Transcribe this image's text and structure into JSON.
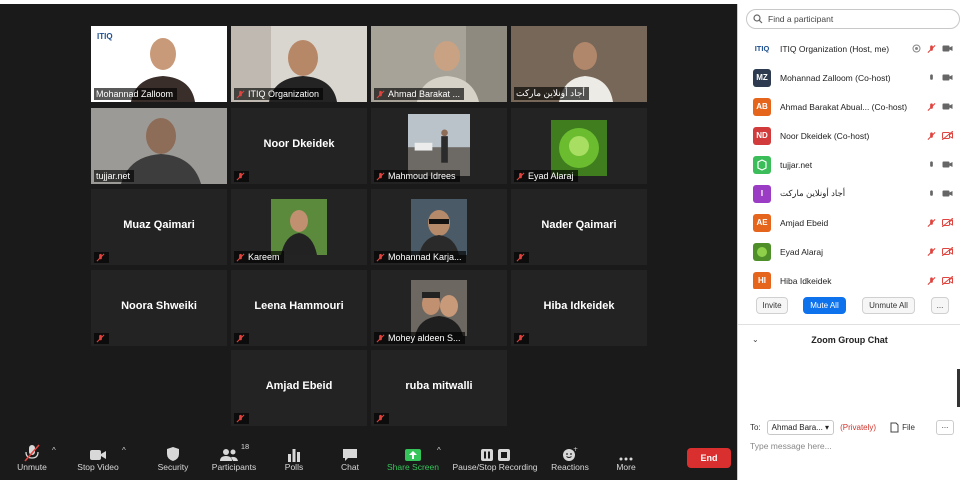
{
  "tiles": [
    {
      "name": "Mohannad Zalloom",
      "logo": "ITIQ",
      "muted": false,
      "active": true
    },
    {
      "name": "ITIQ Organization",
      "muted": true
    },
    {
      "name": "Ahmad Barakat ...",
      "muted": true
    },
    {
      "name": "أجاد أونلاين ماركت",
      "muted": false
    },
    {
      "name": "tujjar.net",
      "muted": false
    },
    {
      "name": "Noor Dkeidek",
      "center": "Noor Dkeidek",
      "muted": true
    },
    {
      "name": "Mahmoud Idrees",
      "muted": true
    },
    {
      "name": "Eyad Alaraj",
      "muted": true
    },
    {
      "center": "Muaz Qaimari",
      "muted": true
    },
    {
      "name": "Kareem",
      "muted": true
    },
    {
      "name": "Mohannad Karja...",
      "muted": true
    },
    {
      "center": "Nader Qaimari",
      "muted": true
    },
    {
      "center": "Noora Shweiki",
      "muted": true
    },
    {
      "center": "Leena Hammouri",
      "muted": true
    },
    {
      "name": "Mohey aldeen S...",
      "muted": true
    },
    {
      "center": "Hiba Idkeidek",
      "muted": true
    },
    {
      "center": "Amjad Ebeid",
      "muted": true
    },
    {
      "center": "ruba mitwalli",
      "muted": true
    }
  ],
  "toolbar": {
    "unmute": "Unmute",
    "stop_video": "Stop Video",
    "security": "Security",
    "participants": "Participants",
    "participants_count": "18",
    "polls": "Polls",
    "chat": "Chat",
    "share_screen": "Share Screen",
    "recording": "Pause/Stop Recording",
    "reactions": "Reactions",
    "more": "More",
    "end": "End"
  },
  "panel": {
    "search_placeholder": "Find a participant",
    "participants": [
      {
        "initials": "ITIQ",
        "name": "ITIQ Organization (Host, me)",
        "color": "#ffffff"
      },
      {
        "initials": "MZ",
        "name": "Mohannad Zalloom (Co-host)",
        "color": "#2d3a4f"
      },
      {
        "initials": "AB",
        "name": "Ahmad Barakat Abual... (Co-host)",
        "color": "#e5651d"
      },
      {
        "initials": "ND",
        "name": "Noor Dkeidek (Co-host)",
        "color": "#d23b3b"
      },
      {
        "initials": "",
        "name": "tujjar.net",
        "color": "#3bbd59"
      },
      {
        "initials": "I",
        "name": "أجاد أونلاين ماركت",
        "color": "#9b3cc4"
      },
      {
        "initials": "AE",
        "name": "Amjad Ebeid",
        "color": "#e5651d"
      },
      {
        "initials": "",
        "name": "Eyad Alaraj",
        "color": "#4f8f2a"
      },
      {
        "initials": "HI",
        "name": "Hiba Idkeidek",
        "color": "#e5651d"
      }
    ],
    "invite": "Invite",
    "mute_all": "Mute All",
    "unmute_all": "Unmute All",
    "more": "...",
    "chat_title": "Zoom Group Chat",
    "to_label": "To:",
    "to_value": "Ahmad Bara...",
    "privately": "(Privately)",
    "file": "File",
    "message_placeholder": "Type message here..."
  },
  "colors": {
    "active_border": "#b4e23a",
    "share_green": "#35c45a",
    "end_red": "#d9302f",
    "mute_all_blue": "#0e72ed",
    "muted_red": "#e0443e"
  }
}
